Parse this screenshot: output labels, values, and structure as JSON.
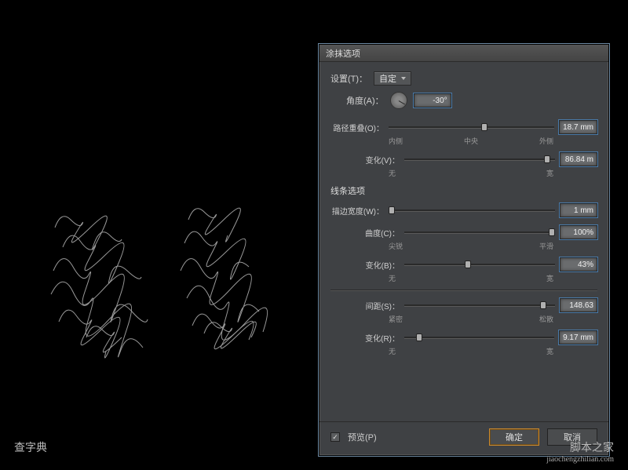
{
  "dialog": {
    "title": "涂抹选项",
    "settings_label": "设置(T)：",
    "settings_value": "自定",
    "angle_label": "角度(A)：",
    "angle_value": "-30°",
    "path_overlap": {
      "label": "路径重叠(O)：",
      "value": "18.7 mm",
      "min_label": "内侧",
      "mid_label": "中央",
      "max_label": "外侧",
      "thumb_pct": 58
    },
    "variation1": {
      "label": "变化(V)：",
      "value": "86.84 m",
      "min_label": "无",
      "max_label": "宽",
      "thumb_pct": 95
    },
    "line_section": "线条选项",
    "stroke_width": {
      "label": "描边宽度(W)：",
      "value": "1 mm",
      "thumb_pct": 2
    },
    "curve": {
      "label": "曲度(C)：",
      "value": "100%",
      "min_label": "尖锐",
      "max_label": "平滑",
      "thumb_pct": 98
    },
    "variation2": {
      "label": "变化(B)：",
      "value": "43%",
      "min_label": "无",
      "max_label": "宽",
      "thumb_pct": 42
    },
    "spacing": {
      "label": "间距(S)：",
      "value": "148.63",
      "min_label": "紧密",
      "max_label": "松散",
      "thumb_pct": 92
    },
    "variation3": {
      "label": "变化(R)：",
      "value": "9.17 mm",
      "min_label": "无",
      "max_label": "宽",
      "thumb_pct": 10
    },
    "preview_label": "预览(P)",
    "ok_label": "确定",
    "cancel_label": "取消"
  },
  "watermark": {
    "left": "查字典",
    "right_main": "脚本之家",
    "right_sub": "jiaochengzhilian.com"
  }
}
